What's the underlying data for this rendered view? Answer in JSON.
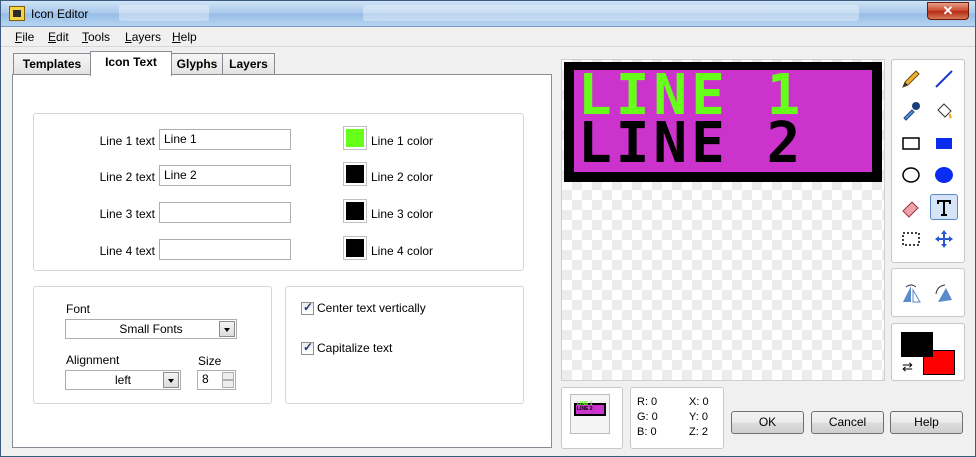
{
  "window": {
    "title": "Icon Editor",
    "close_label": "✕"
  },
  "menu": {
    "items": [
      "File",
      "Edit",
      "Tools",
      "Layers",
      "Help"
    ],
    "mnemonics": [
      "F",
      "E",
      "T",
      "L",
      "H"
    ]
  },
  "tabs": [
    {
      "label": "Templates"
    },
    {
      "label": "Icon Text"
    },
    {
      "label": "Glyphs"
    },
    {
      "label": "Layers"
    }
  ],
  "icon_text": {
    "lines": [
      {
        "label": "Line 1 text",
        "value": "Line 1",
        "color_label": "Line 1 color",
        "color": "#66ff1a"
      },
      {
        "label": "Line 2 text",
        "value": "Line 2",
        "color_label": "Line 2 color",
        "color": "#000000"
      },
      {
        "label": "Line 3 text",
        "value": "",
        "color_label": "Line 3 color",
        "color": "#000000"
      },
      {
        "label": "Line 4 text",
        "value": "",
        "color_label": "Line 4 color",
        "color": "#000000"
      }
    ],
    "font": {
      "label": "Font",
      "value": "Small Fonts"
    },
    "alignment": {
      "label": "Alignment",
      "value": "left"
    },
    "size": {
      "label": "Size",
      "value": "8"
    },
    "center_vertically": {
      "label": "Center text vertically",
      "checked": true
    },
    "capitalize": {
      "label": "Capitalize text",
      "checked": true
    }
  },
  "canvas": {
    "line1": "LINE 1",
    "line2": "LINE 2",
    "background_color": "#cc33cc",
    "border_color": "#000000"
  },
  "preview": {
    "line1": "LINE 1",
    "line2": "LINE 2"
  },
  "coords": {
    "r": "R: 0",
    "g": "G: 0",
    "b": "B: 0",
    "x": "X: 0",
    "y": "Y: 0",
    "z": "Z: 2"
  },
  "colors": {
    "foreground": "#000000",
    "background": "#ff0000",
    "swap_icon": "⇄"
  },
  "tools": [
    "pencil-icon",
    "line-icon",
    "color-picker-icon",
    "fill-icon",
    "rectangle-icon",
    "filled-rectangle-icon",
    "ellipse-icon",
    "filled-ellipse-icon",
    "eraser-icon",
    "text-icon",
    "select-icon",
    "move-icon",
    "flip-horizontal-icon",
    "rotate-icon"
  ],
  "buttons": {
    "ok": "OK",
    "cancel": "Cancel",
    "help": "Help"
  }
}
